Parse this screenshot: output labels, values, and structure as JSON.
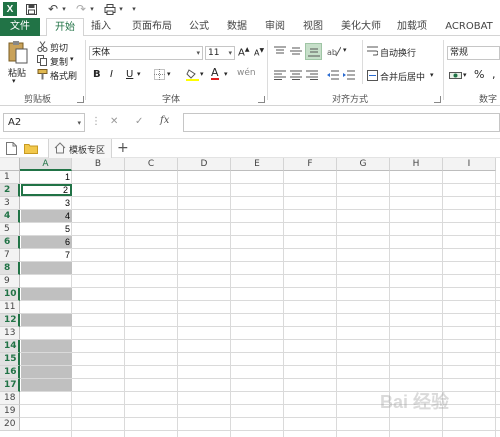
{
  "quick_access": {
    "undo_icon": "↶",
    "redo_icon": "↷",
    "customize_icon": "▾"
  },
  "tabs": [
    {
      "label": "文件"
    },
    {
      "label": "开始"
    },
    {
      "label": "插入"
    },
    {
      "label": "页面布局"
    },
    {
      "label": "公式"
    },
    {
      "label": "数据"
    },
    {
      "label": "审阅"
    },
    {
      "label": "视图"
    },
    {
      "label": "美化大师"
    },
    {
      "label": "加载项"
    },
    {
      "label": "ACROBAT"
    }
  ],
  "ribbon": {
    "clipboard": {
      "paste": "粘贴",
      "cut": "剪切",
      "copy": "复制",
      "format_painter": "格式刷",
      "group": "剪贴板"
    },
    "font": {
      "name": "宋体",
      "size": "11",
      "grow": "A",
      "shrink": "A",
      "bold": "B",
      "italic": "I",
      "underline": "U",
      "underline_dd": "▾",
      "fill_letter": "A",
      "group": "字体"
    },
    "alignment": {
      "wrap": "自动换行",
      "merge": "合并后居中",
      "group": "对齐方式"
    },
    "number": {
      "format": "常规",
      "percent": "%",
      "comma": ",",
      "group": "数字"
    }
  },
  "formula_bar": {
    "name_box": "A2",
    "cancel": "✕",
    "enter": "✓",
    "fx": "fx",
    "value": ""
  },
  "sheet_bar": {
    "tab_label": "模板专区",
    "add": "+"
  },
  "columns": [
    "A",
    "B",
    "C",
    "D",
    "E",
    "F",
    "G",
    "H",
    "I"
  ],
  "rows": [
    "1",
    "2",
    "3",
    "4",
    "5",
    "6",
    "7",
    "8",
    "9",
    "10",
    "11",
    "12",
    "13",
    "14",
    "15",
    "16",
    "17",
    "18",
    "19",
    "20"
  ],
  "cells_a": [
    "1",
    "2",
    "3",
    "4",
    "5",
    "6",
    "7",
    "",
    "",
    "",
    "",
    "",
    "",
    "",
    "",
    "",
    "",
    "",
    "",
    ""
  ],
  "selected_rows": [
    2,
    4,
    6,
    8,
    10,
    12,
    14,
    15,
    16,
    17
  ],
  "grey_rows": [
    4,
    6,
    8,
    10,
    12,
    14,
    15,
    16,
    17
  ],
  "active_cell": "A2",
  "watermark": "Bai 经验",
  "colors": {
    "excel_green": "#217346",
    "selection_grey": "#c0c0c0"
  }
}
